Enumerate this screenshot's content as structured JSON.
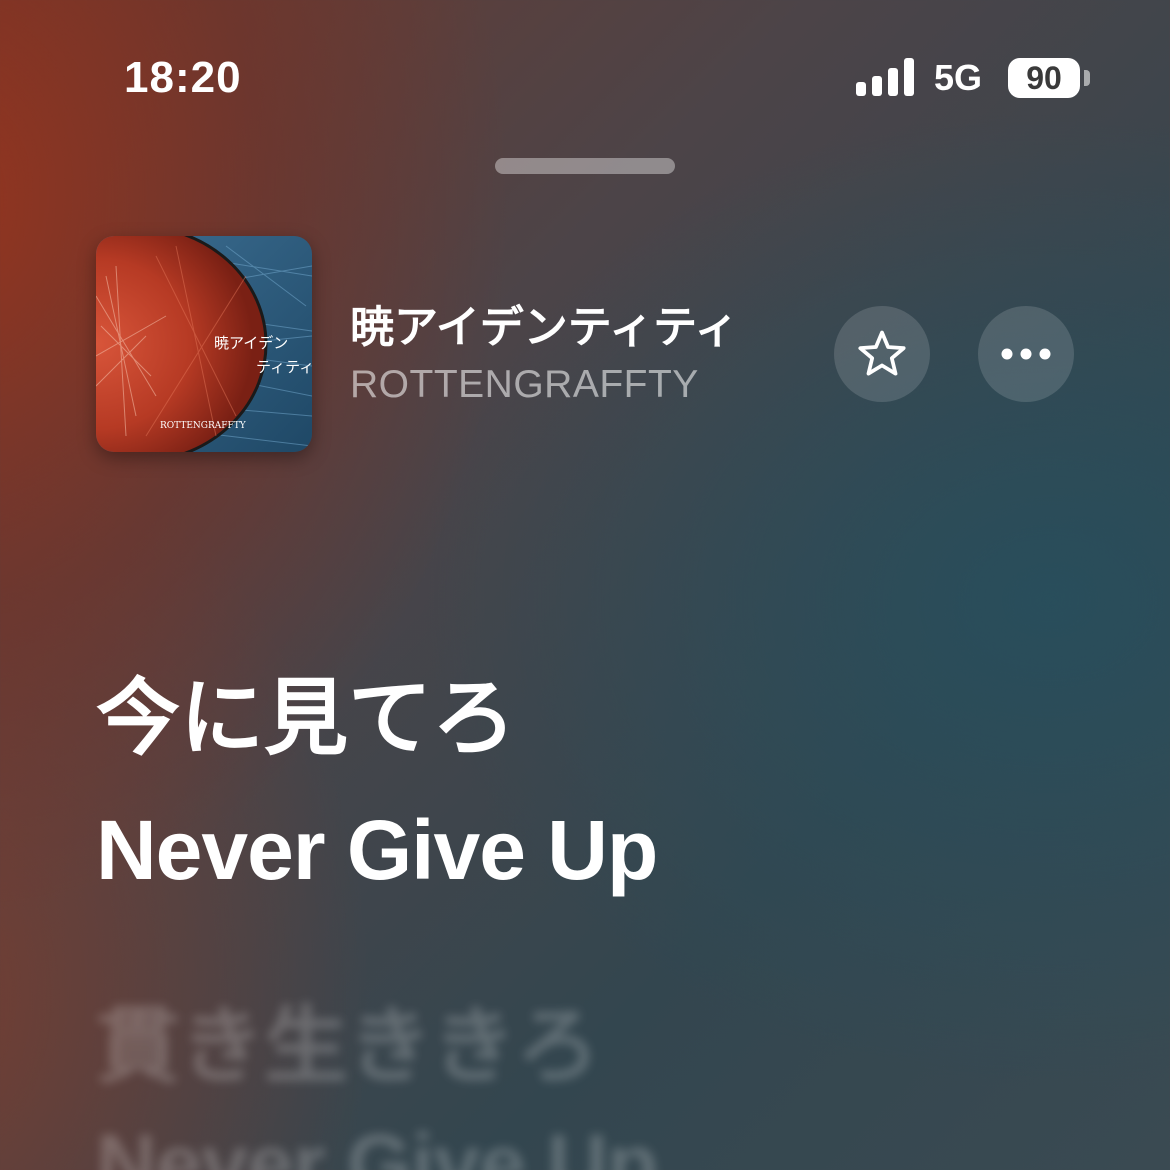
{
  "status_bar": {
    "time": "18:20",
    "network": "5G",
    "battery": "90",
    "signal_bars": 4
  },
  "now_playing": {
    "title": "暁アイデンティティ",
    "artist": "ROTTENGRAFFTY",
    "artwork_text": {
      "title_vertical": "暁アイデン",
      "title_vertical_2": "ティティ",
      "band": "ROTTENGRAFFTY"
    },
    "favorite_icon": "star-outline-icon",
    "more_icon": "ellipsis-icon"
  },
  "lyrics": {
    "current": [
      "今に見てろ",
      "Never Give Up"
    ],
    "upcoming": [
      "貫き生ききろ",
      "Never Give Up"
    ]
  },
  "colors": {
    "warm": "#96341e",
    "cool": "#284e5c",
    "text": "#ffffff"
  }
}
